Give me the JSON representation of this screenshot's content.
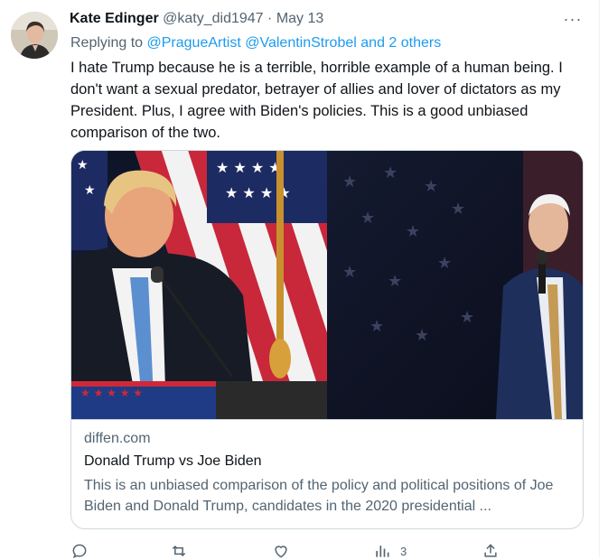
{
  "tweet": {
    "author_name": "Kate Edinger",
    "handle": "@katy_did1947",
    "separator": "·",
    "date": "May 13",
    "replying_prefix": "Replying to",
    "reply_mention_1": "@PragueArtist",
    "reply_mention_2": "@ValentinStrobel",
    "reply_others": "and 2 others",
    "text": "I hate Trump because he is a terrible, horrible example of a human being. I don't want a sexual predator, betrayer of allies and lover of dictators as my President. Plus, I agree with Biden's policies. This is a good unbiased comparison of the two.",
    "more_glyph": "···"
  },
  "card": {
    "domain": "diffen.com",
    "title": "Donald Trump vs Joe Biden",
    "description": "This is an unbiased comparison of the policy and political positions of Joe Biden and Donald Trump, candidates in the 2020 presidential ..."
  },
  "actions": {
    "reply_count": "",
    "retweet_count": "",
    "like_count": "",
    "views_count": "3"
  },
  "colors": {
    "link": "#1d9bf0",
    "secondary_text": "#536471",
    "border": "#cfd9de"
  }
}
